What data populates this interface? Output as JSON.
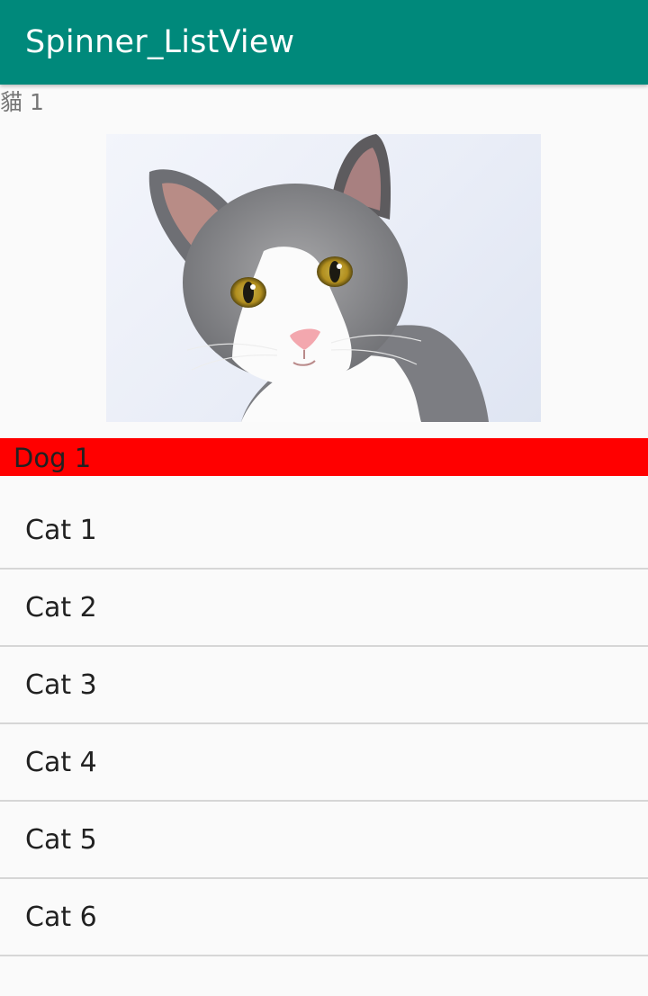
{
  "app_bar": {
    "title": "Spinner_ListView",
    "color": "#00897b"
  },
  "selection": {
    "label": "貓 1"
  },
  "image": {
    "subject": "cat-photo"
  },
  "spinner": {
    "selected_value": "Dog 1",
    "background": "#ff0000"
  },
  "list": {
    "items": [
      {
        "label": "Cat 1"
      },
      {
        "label": "Cat 2"
      },
      {
        "label": "Cat 3"
      },
      {
        "label": "Cat 4"
      },
      {
        "label": "Cat 5"
      },
      {
        "label": "Cat 6"
      }
    ]
  }
}
